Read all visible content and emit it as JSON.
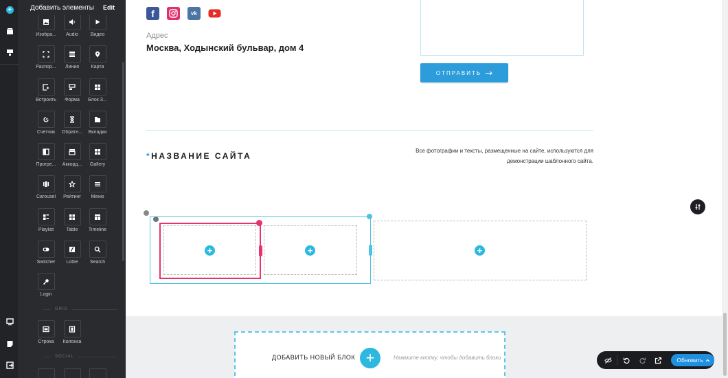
{
  "panel": {
    "title": "Добавить элементы",
    "edit_label": "Edit",
    "items": [
      {
        "label": "Изобра...",
        "icon": "image-icon"
      },
      {
        "label": "Audio",
        "icon": "audio-icon"
      },
      {
        "label": "Видео",
        "icon": "video-icon"
      },
      {
        "label": "Распор...",
        "icon": "spacer-icon"
      },
      {
        "label": "Линия",
        "icon": "line-icon"
      },
      {
        "label": "Карта",
        "icon": "map-pin-icon"
      },
      {
        "label": "Встроить",
        "icon": "embed-icon"
      },
      {
        "label": "Форма",
        "icon": "form-icon"
      },
      {
        "label": "Блок З...",
        "icon": "block-icon"
      },
      {
        "label": "Счетчик",
        "icon": "counter-icon"
      },
      {
        "label": "Обратн...",
        "icon": "hourglass-icon"
      },
      {
        "label": "Вкладки",
        "icon": "tabs-icon"
      },
      {
        "label": "Прогре...",
        "icon": "progress-icon"
      },
      {
        "label": "Аккорд...",
        "icon": "accordion-icon"
      },
      {
        "label": "Gallery",
        "icon": "gallery-icon"
      },
      {
        "label": "Carousel",
        "icon": "carousel-icon"
      },
      {
        "label": "Рейтинг",
        "icon": "star-icon"
      },
      {
        "label": "Меню",
        "icon": "menu-icon"
      },
      {
        "label": "Playlist",
        "icon": "playlist-icon"
      },
      {
        "label": "Table",
        "icon": "table-icon"
      },
      {
        "label": "Timeline",
        "icon": "timeline-icon"
      },
      {
        "label": "Switcher",
        "icon": "switcher-icon"
      },
      {
        "label": "Lottie",
        "icon": "lottie-icon"
      },
      {
        "label": "Search",
        "icon": "search-icon"
      },
      {
        "label": "Login",
        "icon": "key-icon"
      }
    ],
    "grid_section": "GRID",
    "grid_items": [
      {
        "label": "Строка",
        "icon": "row-icon"
      },
      {
        "label": "Колонка",
        "icon": "column-icon"
      }
    ],
    "social_section": "SOCIAL"
  },
  "page": {
    "address_label": "Адрес",
    "address_value": "Москва, Ходынский бульвар, дом 4",
    "send_label": "ОТПРАВИТЬ",
    "site_name_star": "*",
    "site_name": "НАЗВАНИЕ САЙТА",
    "disclaimer_line1": "Все фотографии и тексты, размещенные на сайте, используются для",
    "disclaimer_line2": "демонстрации шаблонного сайта.",
    "social": [
      "facebook-icon",
      "instagram-icon",
      "vk-icon",
      "youtube-icon"
    ]
  },
  "add_block": {
    "title": "ДОБАВИТЬ НОВЫЙ БЛОК",
    "hint": "Нажмите кнопку, чтобы добавить блоки"
  },
  "toolbar": {
    "update_label": "Обновить"
  },
  "colors": {
    "accent": "#2db8e0",
    "button": "#2d9cdb",
    "selection": "#e8336d",
    "panel_bg": "#2a2b2e",
    "rail_bg": "#222326"
  }
}
